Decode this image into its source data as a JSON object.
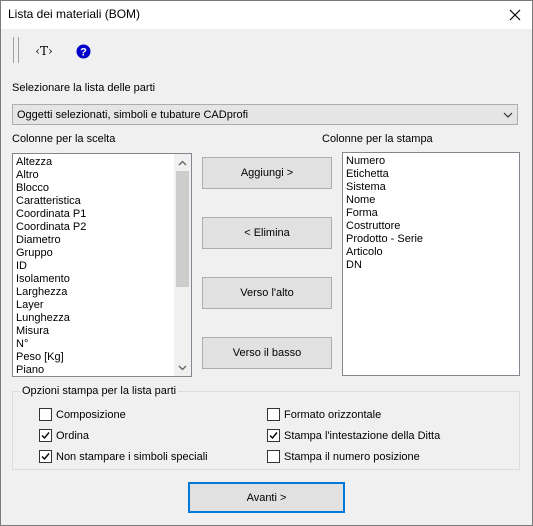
{
  "window": {
    "title": "Lista dei materiali (BOM)"
  },
  "toolbar": {
    "text_tool": "‹T›"
  },
  "parts_list": {
    "label": "Selezionare la lista delle parti",
    "selected": "Oggetti selezionati, simboli e tubature CADprofi"
  },
  "available_columns": {
    "label": "Colonne per la scelta",
    "items": [
      "Altezza",
      "Altro",
      "Blocco",
      "Caratteristica",
      "Coordinata P1",
      "Coordinata P2",
      "Diametro",
      "Gruppo",
      "ID",
      "Isolamento",
      "Larghezza",
      "Layer",
      "Lunghezza",
      "Misura",
      "N°",
      "Peso [Kg]",
      "Piano"
    ]
  },
  "print_columns": {
    "label": "Colonne per la stampa",
    "items": [
      "Numero",
      "Etichetta",
      "Sistema",
      "Nome",
      "Forma",
      "Costruttore",
      "Prodotto - Serie",
      "Articolo",
      "DN"
    ]
  },
  "buttons": {
    "add": "Aggiungi >",
    "remove": "< Elimina",
    "up": "Verso l'alto",
    "down": "Verso il basso",
    "next": "Avanti >"
  },
  "print_options": {
    "title": "Opzioni stampa per la lista parti",
    "composition": {
      "label": "Composizione",
      "checked": false
    },
    "sort": {
      "label": "Ordina",
      "checked": true
    },
    "no_special_symbols": {
      "label": "Non stampare i simboli speciali",
      "checked": true
    },
    "horizontal_format": {
      "label": "Formato orizzontale",
      "checked": false
    },
    "print_company_header": {
      "label": "Stampa l'intestazione della Ditta",
      "checked": true
    },
    "print_position_number": {
      "label": "Stampa il numero posizione",
      "checked": false
    }
  },
  "colors": {
    "accent": "#0078d7",
    "help_icon": "#0000c8"
  }
}
